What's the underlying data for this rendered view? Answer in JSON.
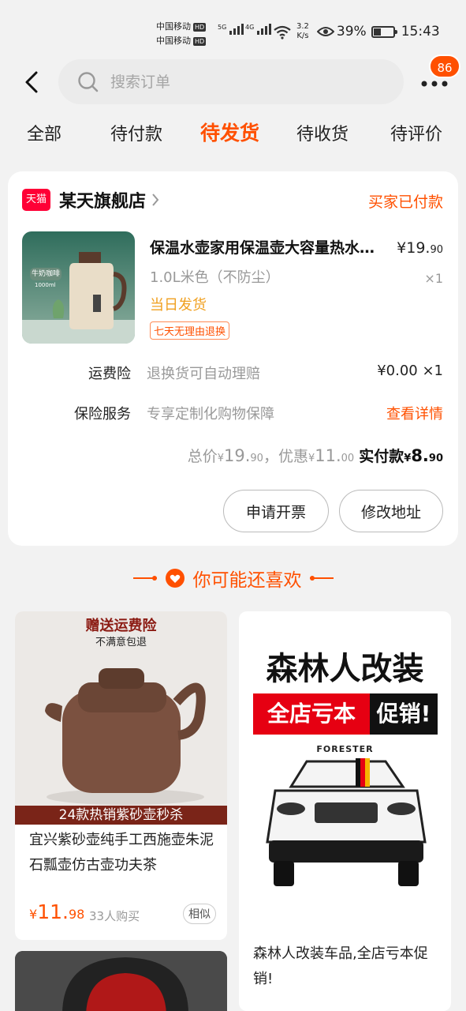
{
  "status_bar": {
    "carrier_1": "中国移动",
    "carrier_2": "中国移动",
    "hd_label": "HD",
    "net_5g": "5G",
    "net_4g": "4G",
    "speed_value": "3.2",
    "speed_unit": "K/s",
    "battery": "39%",
    "time": "15:43"
  },
  "header": {
    "search_placeholder": "搜索订单",
    "badge_count": "86"
  },
  "tabs": [
    {
      "label": "全部"
    },
    {
      "label": "待付款"
    },
    {
      "label": "待发货",
      "active": true
    },
    {
      "label": "待收货"
    },
    {
      "label": "待评价"
    }
  ],
  "order": {
    "shop_tag": "天猫",
    "shop_name": "某天旗舰店",
    "status": "买家已付款",
    "product": {
      "image_label_1": "牛奶咖啡",
      "image_label_2": "1000ml",
      "title": "保温水壶家用保温壶大容量热水瓶开水瓶",
      "price_symbol": "¥",
      "price_int": "19.",
      "price_dec": "90",
      "sku": "1.0L米色（不防尘）",
      "qty": "×1",
      "shipping": "当日发货",
      "return_tag": "七天无理由退换"
    },
    "rows": [
      {
        "label": "运费险",
        "desc": "退换货可自动理赔",
        "value": "¥0.00 ×1"
      },
      {
        "label": "保险服务",
        "desc": "专享定制化购物保障",
        "link": "查看详情"
      }
    ],
    "totals": {
      "total_label": "总价",
      "total_symbol": "¥",
      "total_int": "19.",
      "total_dec": "90",
      "sep": "，",
      "discount_label": "优惠",
      "discount_symbol": "¥",
      "discount_int": "11.",
      "discount_dec": "00",
      "paid_label": "实付款",
      "paid_symbol": "¥",
      "paid_int": "8.",
      "paid_dec": "90"
    },
    "buttons": {
      "invoice": "申请开票",
      "address": "修改地址"
    }
  },
  "recommend": {
    "header": "你可能还喜欢",
    "items": [
      {
        "banner_top": "赠送运费险",
        "banner_sub": "不满意包退",
        "banner_bottom": "24款热销紫砂壶秒杀",
        "title": "宜兴紫砂壶纯手工西施壶朱泥石瓢壶仿古壶功夫茶",
        "price_symbol": "¥",
        "price_int": "11.",
        "price_dec": "98",
        "buyers": "33人购买",
        "similar": "相似"
      },
      {
        "brand": "森林人改装",
        "promo_red": "全店亏本",
        "promo_black": "促销!",
        "car_label": "FORESTER",
        "title": "森林人改装车品,全店亏本促销!"
      }
    ]
  },
  "colors": {
    "accent": "#ff5000",
    "tmall_red": "#ff0036",
    "ship_orange": "#f0a020"
  }
}
